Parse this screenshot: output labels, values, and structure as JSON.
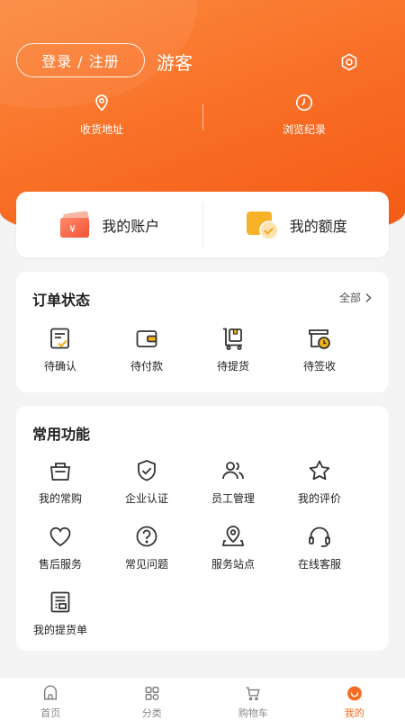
{
  "colors": {
    "accent": "#f66b22",
    "icon_dark": "#333333",
    "icon_yellow": "#f5b31a"
  },
  "header": {
    "login_label": "登录 / 注册",
    "guest_label": "游客",
    "settings_icon": "settings-icon",
    "links": [
      {
        "label": "收货地址",
        "icon": "location-icon"
      },
      {
        "label": "浏览纪录",
        "icon": "clock-icon"
      }
    ]
  },
  "account": {
    "items": [
      {
        "label": "我的账户",
        "icon": "wallet-card-icon"
      },
      {
        "label": "我的额度",
        "icon": "credit-icon"
      }
    ]
  },
  "orders": {
    "title": "订单状态",
    "more_label": "全部",
    "items": [
      {
        "label": "待确认"
      },
      {
        "label": "待付款"
      },
      {
        "label": "待提货"
      },
      {
        "label": "待签收"
      }
    ]
  },
  "functions": {
    "title": "常用功能",
    "items": [
      {
        "label": "我的常购"
      },
      {
        "label": "企业认证"
      },
      {
        "label": "员工管理"
      },
      {
        "label": "我的评价"
      },
      {
        "label": "售后服务"
      },
      {
        "label": "常见问题"
      },
      {
        "label": "服务站点"
      },
      {
        "label": "在线客服"
      },
      {
        "label": "我的提货单"
      }
    ]
  },
  "tabbar": {
    "items": [
      {
        "label": "首页"
      },
      {
        "label": "分类"
      },
      {
        "label": "购物车"
      },
      {
        "label": "我的"
      }
    ]
  }
}
